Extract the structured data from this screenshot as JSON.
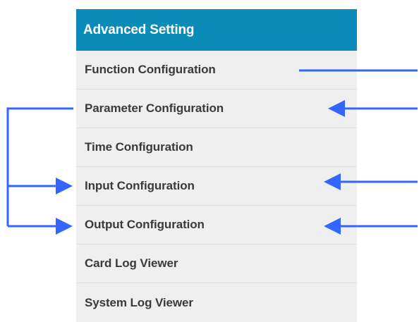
{
  "menu": {
    "header": "Advanced Setting",
    "items": [
      {
        "label": "Function Configuration"
      },
      {
        "label": "Parameter Configuration"
      },
      {
        "label": "Time Configuration"
      },
      {
        "label": "Input Configuration"
      },
      {
        "label": "Output Configuration"
      },
      {
        "label": "Card Log Viewer"
      },
      {
        "label": "System Log Viewer"
      }
    ]
  },
  "colors": {
    "header_bg": "#0a8bb8",
    "header_text": "#ffffff",
    "item_bg": "#efefef",
    "item_text": "#3a3a3a",
    "annotation": "#3366ff"
  }
}
